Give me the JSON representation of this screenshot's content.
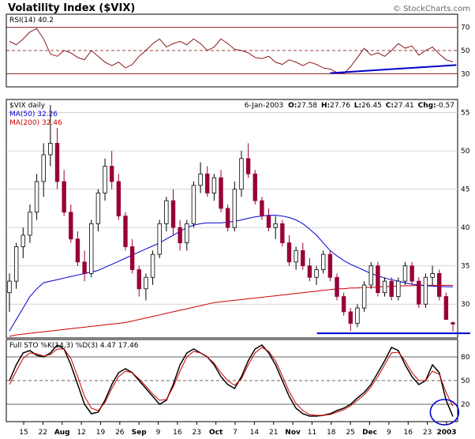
{
  "title": "Volatility Index ($VIX)",
  "copyright": "© StockCharts.com",
  "chart_data": [
    {
      "type": "line",
      "panel": "rsi",
      "label": "RSI(14) 40.2",
      "ylim": [
        20,
        80
      ],
      "yticks": [
        30,
        50,
        70
      ],
      "reference_lines": [
        30,
        50,
        70
      ],
      "series": [
        {
          "name": "RSI(14)",
          "color": "#800000",
          "values": [
            58,
            55,
            60,
            66,
            69,
            60,
            47,
            45,
            50,
            48,
            44,
            42,
            50,
            45,
            40,
            37,
            40,
            35,
            38,
            45,
            50,
            56,
            60,
            53,
            56,
            58,
            55,
            60,
            56,
            50,
            53,
            60,
            56,
            51,
            50,
            48,
            44,
            43,
            45,
            40,
            38,
            42,
            40,
            37,
            40,
            38,
            35,
            34,
            31,
            30,
            36,
            44,
            52,
            46,
            48,
            45,
            50,
            56,
            52,
            54,
            46,
            50,
            53,
            47,
            42,
            40.2
          ]
        }
      ],
      "trendline": {
        "color": "#0000cc",
        "from": [
          47,
          30.5
        ],
        "to": [
          65.5,
          37.5
        ]
      }
    },
    {
      "type": "candlestick",
      "panel": "price",
      "labels": {
        "symbol": "$VIX daily",
        "ma50": "MA(50) 32.26",
        "ma200": "MA(200) 32.46",
        "ohlc": "6-Jan-2003",
        "o_lbl": "O:",
        "o_val": "27.58",
        "h_lbl": "H:",
        "h_val": "27.76",
        "l_lbl": "L:",
        "l_val": "26.45",
        "c_lbl": "C:",
        "c_val": "27.41",
        "chg_lbl": "Chg:",
        "chg_val": "-0.57"
      },
      "ylim": [
        25.8,
        56.5
      ],
      "yticks": [
        30,
        35,
        40,
        45,
        50,
        55
      ],
      "colors": {
        "up": "#000000",
        "down": "#99003a",
        "ma50": "#0000cc",
        "ma200": "#cc0000"
      },
      "series": [
        {
          "name": "$VIX",
          "ohlc": [
            [
              31.5,
              34.0,
              29.0,
              33.0
            ],
            [
              33.0,
              38.0,
              32.0,
              37.5
            ],
            [
              37.5,
              40.0,
              36.0,
              39.0
            ],
            [
              39.0,
              43.0,
              38.0,
              42.0
            ],
            [
              42.0,
              47.0,
              41.0,
              46.0
            ],
            [
              46.0,
              51.0,
              44.0,
              49.5
            ],
            [
              49.5,
              56.0,
              48.0,
              51.0
            ],
            [
              51.0,
              53.0,
              45.0,
              46.0
            ],
            [
              46.0,
              47.5,
              41.5,
              42.0
            ],
            [
              42.0,
              43.0,
              38.0,
              38.5
            ],
            [
              38.5,
              39.5,
              35.0,
              35.5
            ],
            [
              35.5,
              37.0,
              33.0,
              34.0
            ],
            [
              34.0,
              41.0,
              33.5,
              40.5
            ],
            [
              40.5,
              45.0,
              39.5,
              44.5
            ],
            [
              44.5,
              49.0,
              43.5,
              48.0
            ],
            [
              48.0,
              50.0,
              45.0,
              46.0
            ],
            [
              46.0,
              47.0,
              41.0,
              41.5
            ],
            [
              41.5,
              42.0,
              37.0,
              37.5
            ],
            [
              37.5,
              38.5,
              34.0,
              34.5
            ],
            [
              34.5,
              35.0,
              31.0,
              32.0
            ],
            [
              32.0,
              34.0,
              30.5,
              33.5
            ],
            [
              33.5,
              37.0,
              32.5,
              36.5
            ],
            [
              36.5,
              41.0,
              36.0,
              40.5
            ],
            [
              40.5,
              44.0,
              39.5,
              43.5
            ],
            [
              43.5,
              45.0,
              39.0,
              40.0
            ],
            [
              40.0,
              41.0,
              37.0,
              38.0
            ],
            [
              38.0,
              41.0,
              37.0,
              40.5
            ],
            [
              40.5,
              46.0,
              40.0,
              45.5
            ],
            [
              45.5,
              48.5,
              44.5,
              47.0
            ],
            [
              47.0,
              48.0,
              44.0,
              44.5
            ],
            [
              44.5,
              47.0,
              43.5,
              46.5
            ],
            [
              46.5,
              47.5,
              42.0,
              42.5
            ],
            [
              42.5,
              43.0,
              39.5,
              40.0
            ],
            [
              40.0,
              46.0,
              39.5,
              45.0
            ],
            [
              45.0,
              50.0,
              44.0,
              49.0
            ],
            [
              49.0,
              51.0,
              46.5,
              47.0
            ],
            [
              47.0,
              47.5,
              43.0,
              43.5
            ],
            [
              43.5,
              44.0,
              41.0,
              41.5
            ],
            [
              41.5,
              42.5,
              39.5,
              40.0
            ],
            [
              40.0,
              41.5,
              38.5,
              40.5
            ],
            [
              40.5,
              41.0,
              37.5,
              38.0
            ],
            [
              38.0,
              39.0,
              35.0,
              35.5
            ],
            [
              35.5,
              37.5,
              34.5,
              37.0
            ],
            [
              37.0,
              38.0,
              34.5,
              35.0
            ],
            [
              35.0,
              36.0,
              33.0,
              33.5
            ],
            [
              33.5,
              35.0,
              32.5,
              34.5
            ],
            [
              34.5,
              37.0,
              34.0,
              36.5
            ],
            [
              36.5,
              37.0,
              33.0,
              33.5
            ],
            [
              33.5,
              34.0,
              30.5,
              31.0
            ],
            [
              31.0,
              31.5,
              28.5,
              29.0
            ],
            [
              29.0,
              29.5,
              26.5,
              27.5
            ],
            [
              27.5,
              30.0,
              27.0,
              29.5
            ],
            [
              29.5,
              33.0,
              29.0,
              32.5
            ],
            [
              32.5,
              35.5,
              32.0,
              35.0
            ],
            [
              35.0,
              35.5,
              31.0,
              31.5
            ],
            [
              31.5,
              33.5,
              31.0,
              33.0
            ],
            [
              33.0,
              33.5,
              30.5,
              31.0
            ],
            [
              31.0,
              33.5,
              30.5,
              33.0
            ],
            [
              33.0,
              35.5,
              32.5,
              35.0
            ],
            [
              35.0,
              35.5,
              32.5,
              33.0
            ],
            [
              33.0,
              33.5,
              29.5,
              30.0
            ],
            [
              30.0,
              34.0,
              29.5,
              33.5
            ],
            [
              33.5,
              35.0,
              32.5,
              34.0
            ],
            [
              34.0,
              34.5,
              30.5,
              31.0
            ],
            [
              31.0,
              31.5,
              28.0,
              28.0
            ],
            [
              27.58,
              27.76,
              26.45,
              27.41
            ]
          ],
          "ma50": [
            26.5,
            28.0,
            29.5,
            31.0,
            32.0,
            32.8,
            33.0,
            33.2,
            33.4,
            33.6,
            33.8,
            34.0,
            34.2,
            34.4,
            34.8,
            35.2,
            35.6,
            36.0,
            36.4,
            36.8,
            37.2,
            37.6,
            38.0,
            38.5,
            39.0,
            39.5,
            40.0,
            40.3,
            40.5,
            40.6,
            40.6,
            40.6,
            40.7,
            40.8,
            41.0,
            41.2,
            41.4,
            41.5,
            41.6,
            41.6,
            41.5,
            41.3,
            41.0,
            40.5,
            39.8,
            39.0,
            38.0,
            37.0,
            36.3,
            35.7,
            35.2,
            34.8,
            34.4,
            34.0,
            33.7,
            33.4,
            33.2,
            33.0,
            32.8,
            32.6,
            32.5,
            32.4,
            32.35,
            32.3,
            32.28,
            32.26
          ],
          "ma200": [
            25.8,
            26.0,
            26.1,
            26.2,
            26.3,
            26.4,
            26.5,
            26.6,
            26.7,
            26.8,
            26.9,
            27.0,
            27.1,
            27.2,
            27.3,
            27.4,
            27.5,
            27.6,
            27.8,
            28.0,
            28.2,
            28.4,
            28.6,
            28.8,
            29.0,
            29.2,
            29.4,
            29.6,
            29.8,
            30.0,
            30.2,
            30.3,
            30.4,
            30.5,
            30.6,
            30.7,
            30.8,
            30.9,
            31.0,
            31.1,
            31.2,
            31.3,
            31.4,
            31.5,
            31.6,
            31.7,
            31.8,
            31.9,
            32.0,
            32.0,
            32.1,
            32.1,
            32.2,
            32.2,
            32.25,
            32.3,
            32.3,
            32.35,
            32.4,
            32.4,
            32.45,
            32.45,
            32.46,
            32.46,
            32.46,
            32.46
          ]
        }
      ],
      "support_line": {
        "color": "#0000cc",
        "value": 26.2,
        "from_bar": 46,
        "to_bar": 65
      }
    },
    {
      "type": "line",
      "panel": "stochastic",
      "label": "Full STO %K(14,3) %D(3) 4.47 17.46",
      "ylim": [
        0,
        100
      ],
      "yticks": [
        20,
        50,
        80
      ],
      "reference_lines": [
        20,
        50,
        80
      ],
      "series": [
        {
          "name": "%K",
          "color": "#000000",
          "values": [
            50,
            70,
            85,
            88,
            82,
            80,
            85,
            95,
            90,
            70,
            45,
            20,
            8,
            10,
            25,
            45,
            60,
            65,
            60,
            50,
            40,
            30,
            20,
            25,
            45,
            70,
            85,
            90,
            85,
            80,
            70,
            55,
            45,
            40,
            55,
            75,
            90,
            95,
            85,
            70,
            50,
            30,
            15,
            8,
            5,
            5,
            6,
            8,
            12,
            15,
            20,
            28,
            35,
            45,
            60,
            75,
            92,
            88,
            70,
            55,
            45,
            50,
            70,
            60,
            25,
            4.47
          ]
        },
        {
          "name": "%D",
          "color": "#cc0000",
          "values": [
            45,
            62,
            78,
            85,
            84,
            81,
            83,
            90,
            90,
            78,
            55,
            30,
            15,
            12,
            22,
            40,
            55,
            62,
            60,
            52,
            43,
            33,
            25,
            26,
            42,
            62,
            80,
            87,
            85,
            80,
            72,
            60,
            50,
            44,
            52,
            70,
            85,
            92,
            87,
            75,
            56,
            36,
            21,
            12,
            7,
            6,
            6,
            7,
            10,
            13,
            18,
            25,
            32,
            42,
            55,
            70,
            85,
            86,
            75,
            60,
            50,
            50,
            62,
            58,
            35,
            17.46
          ]
        }
      ],
      "highlight_circle": {
        "color": "#0000cc"
      }
    }
  ],
  "x_axis": {
    "labels": [
      {
        "text": "15",
        "bold": false
      },
      {
        "text": "22",
        "bold": false
      },
      {
        "text": "Aug",
        "bold": true
      },
      {
        "text": "12",
        "bold": false
      },
      {
        "text": "19",
        "bold": false
      },
      {
        "text": "26",
        "bold": false
      },
      {
        "text": "Sep",
        "bold": true
      },
      {
        "text": "9",
        "bold": false
      },
      {
        "text": "16",
        "bold": false
      },
      {
        "text": "23",
        "bold": false
      },
      {
        "text": "Oct",
        "bold": true
      },
      {
        "text": "7",
        "bold": false
      },
      {
        "text": "14",
        "bold": false
      },
      {
        "text": "21",
        "bold": false
      },
      {
        "text": "Nov",
        "bold": true
      },
      {
        "text": "11",
        "bold": false
      },
      {
        "text": "18",
        "bold": false
      },
      {
        "text": "25",
        "bold": false
      },
      {
        "text": "Dec",
        "bold": true
      },
      {
        "text": "9",
        "bold": false
      },
      {
        "text": "16",
        "bold": false
      },
      {
        "text": "23",
        "bold": false
      },
      {
        "text": "2003",
        "bold": true
      }
    ]
  }
}
